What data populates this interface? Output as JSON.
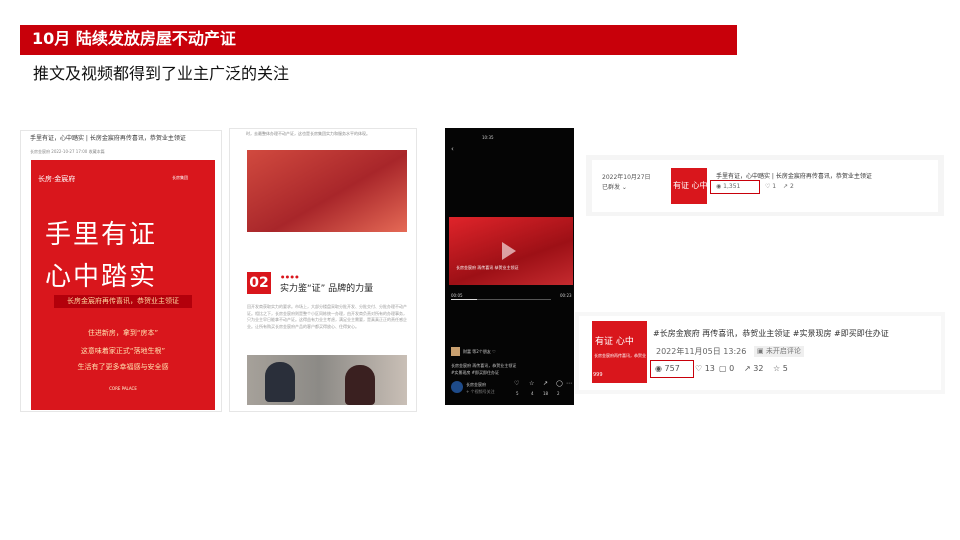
{
  "banner": {
    "title": "10月 陆续发放房屋不动产证"
  },
  "subtitle": "推文及视频都得到了业主广泛的关注",
  "panel1": {
    "headline": "手里有证，心中踏实 | 长房金宸府再传喜讯，恭贺业主领证",
    "meta": "长房金宸府  2022-10-27 17:00  收藏本篇",
    "poster_logo": "长房·金宸府",
    "poster_brand": "长房集团",
    "poster_line1": "手里有证",
    "poster_line2": "心中踏实",
    "poster_tag": "长房金宸府再传喜讯，恭贺业主领证",
    "poster_lines": [
      "住进新房，拿到“房本”",
      "这意味着家正式“落地生根”",
      "生活有了更多幸福感与安全感"
    ],
    "poster_footer": "CORE PALACE"
  },
  "panel2": {
    "intro": "时，去最整体办理不动产证，这也是长房集团实力和服务水平的体现。",
    "section_num": "02",
    "section_title": "实力鉴“证” 品牌的力量",
    "body": "回开发商获取实力的要求。市场上，大部分楼盘采取分批开发、分批交付、分批办理不动产证。相比之下，长房金宸府则是整个小区同栋统一办理，由开发商负责对所有的办理事务，只为业主早日能拿不动产证。这得益有力业主考虑，满足业主需要，是真真正正的责任感企业。让所有购买长房金宸府产品的客户都买得放心、住得安心。"
  },
  "panel3": {
    "time": "10:35",
    "back": "‹",
    "video_caption": "长房金宸府 再传喜讯 恭贺业主领证",
    "time_left": "00:05",
    "time_right": "00:23",
    "comment": "财富 等2个朋友 ♡",
    "desc_lines": [
      "长房金宸府 再传喜讯，恭贺业主领证",
      "#实景现房 #即买即住办证"
    ],
    "account": "长房金宸府",
    "account_sub": "+ 个视频号关注",
    "actions": [
      "♡",
      "☆",
      "↗",
      "◯",
      "⋯"
    ],
    "action_counts": [
      "5",
      "4",
      "18",
      "2",
      ""
    ]
  },
  "panel4": {
    "date": "2022年10月27日",
    "status": "已群发 ⌄",
    "thumb_text": "有证 心中",
    "title": "手里有证，心中踏实 | 长房金宸府再传喜讯，恭贺业主领证",
    "views": "1,351",
    "likes": "1",
    "shares": "2"
  },
  "panel5": {
    "thumb_text": "有证 心中",
    "thumb_sub": "长房金宸府再传喜讯，恭贺业",
    "thumb_num": "999",
    "tags": "#长房金宸府 再传喜讯，恭贺业主领证 #实景现房 #即买即住办证",
    "date": "2022年11月05日 13:26",
    "badge": "未开启评论",
    "views": "757",
    "likes": "13",
    "comments": "0",
    "shares": "32",
    "stars": "5"
  }
}
